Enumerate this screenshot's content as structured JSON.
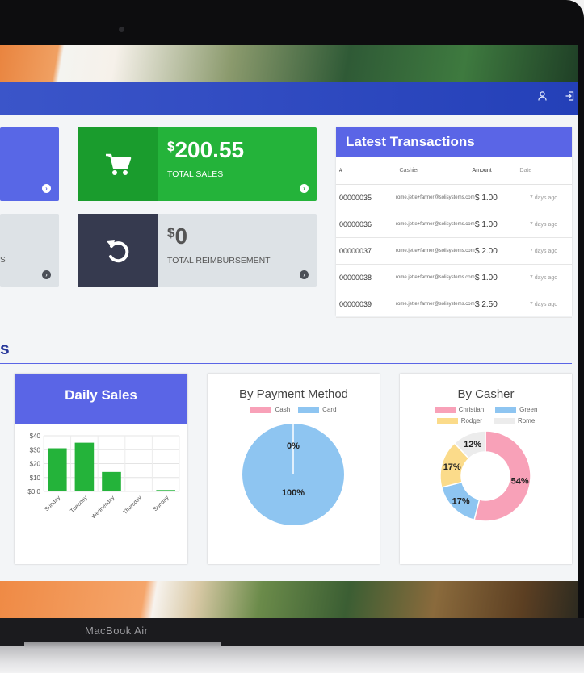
{
  "device": {
    "brand": "MacBook Air"
  },
  "nav": {
    "icons": [
      "user-icon",
      "logout-icon"
    ]
  },
  "stats": {
    "sales_symbol": "$",
    "sales_value": "200.55",
    "sales_label": "TOTAL SALES",
    "reimb_symbol": "$",
    "reimb_value": "0",
    "reimb_label": "TOTAL REIMBURSEMENT",
    "left_fragment": "S"
  },
  "transactions": {
    "title": "Latest Transactions",
    "columns": [
      "#",
      "Cashier",
      "Amount",
      "Date"
    ],
    "rows": [
      {
        "id": "00000035",
        "cashier": "rome.jette+farmer@solisystems.com",
        "amount": "$ 1.00",
        "date": "7 days ago"
      },
      {
        "id": "00000036",
        "cashier": "rome.jette+farmer@solisystems.com",
        "amount": "$ 1.00",
        "date": "7 days ago"
      },
      {
        "id": "00000037",
        "cashier": "rome.jette+farmer@solisystems.com",
        "amount": "$ 2.00",
        "date": "7 days ago"
      },
      {
        "id": "00000038",
        "cashier": "rome.jette+farmer@solisystems.com",
        "amount": "$ 1.00",
        "date": "7 days ago"
      },
      {
        "id": "00000039",
        "cashier": "rome.jette+farmer@solisystems.com",
        "amount": "$ 2.50",
        "date": "7 days ago"
      }
    ]
  },
  "section": {
    "title": "s"
  },
  "colors": {
    "accent": "#5a65e6",
    "green": "#24b33a",
    "pink": "#f8a1b8",
    "blue": "#8ec5f1",
    "yellow": "#fbdb8a",
    "grey": "#ececec"
  },
  "chart_data": [
    {
      "type": "bar",
      "title": "Daily Sales",
      "categories": [
        "Sunday",
        "Tuesday",
        "Wednesday",
        "Thursday",
        "Sunday"
      ],
      "values": [
        31,
        35,
        14,
        0.5,
        1
      ],
      "yticks": [
        "$40",
        "$30",
        "$20",
        "$10",
        "$0.0"
      ],
      "ylim": [
        0,
        40
      ],
      "grid": true
    },
    {
      "type": "pie",
      "title": "By Payment Method",
      "legend": [
        "Cash",
        "Card"
      ],
      "legend_position": "top",
      "values": [
        0,
        100
      ],
      "labels": [
        "0%",
        "100%"
      ]
    },
    {
      "type": "pie",
      "title": "By Casher",
      "legend": [
        "Christian",
        "Green",
        "Rodger",
        "Rome"
      ],
      "legend_position": "top",
      "values": [
        54,
        17,
        17,
        12
      ],
      "labels": [
        "54%",
        "17%",
        "17%",
        "12%"
      ]
    }
  ]
}
